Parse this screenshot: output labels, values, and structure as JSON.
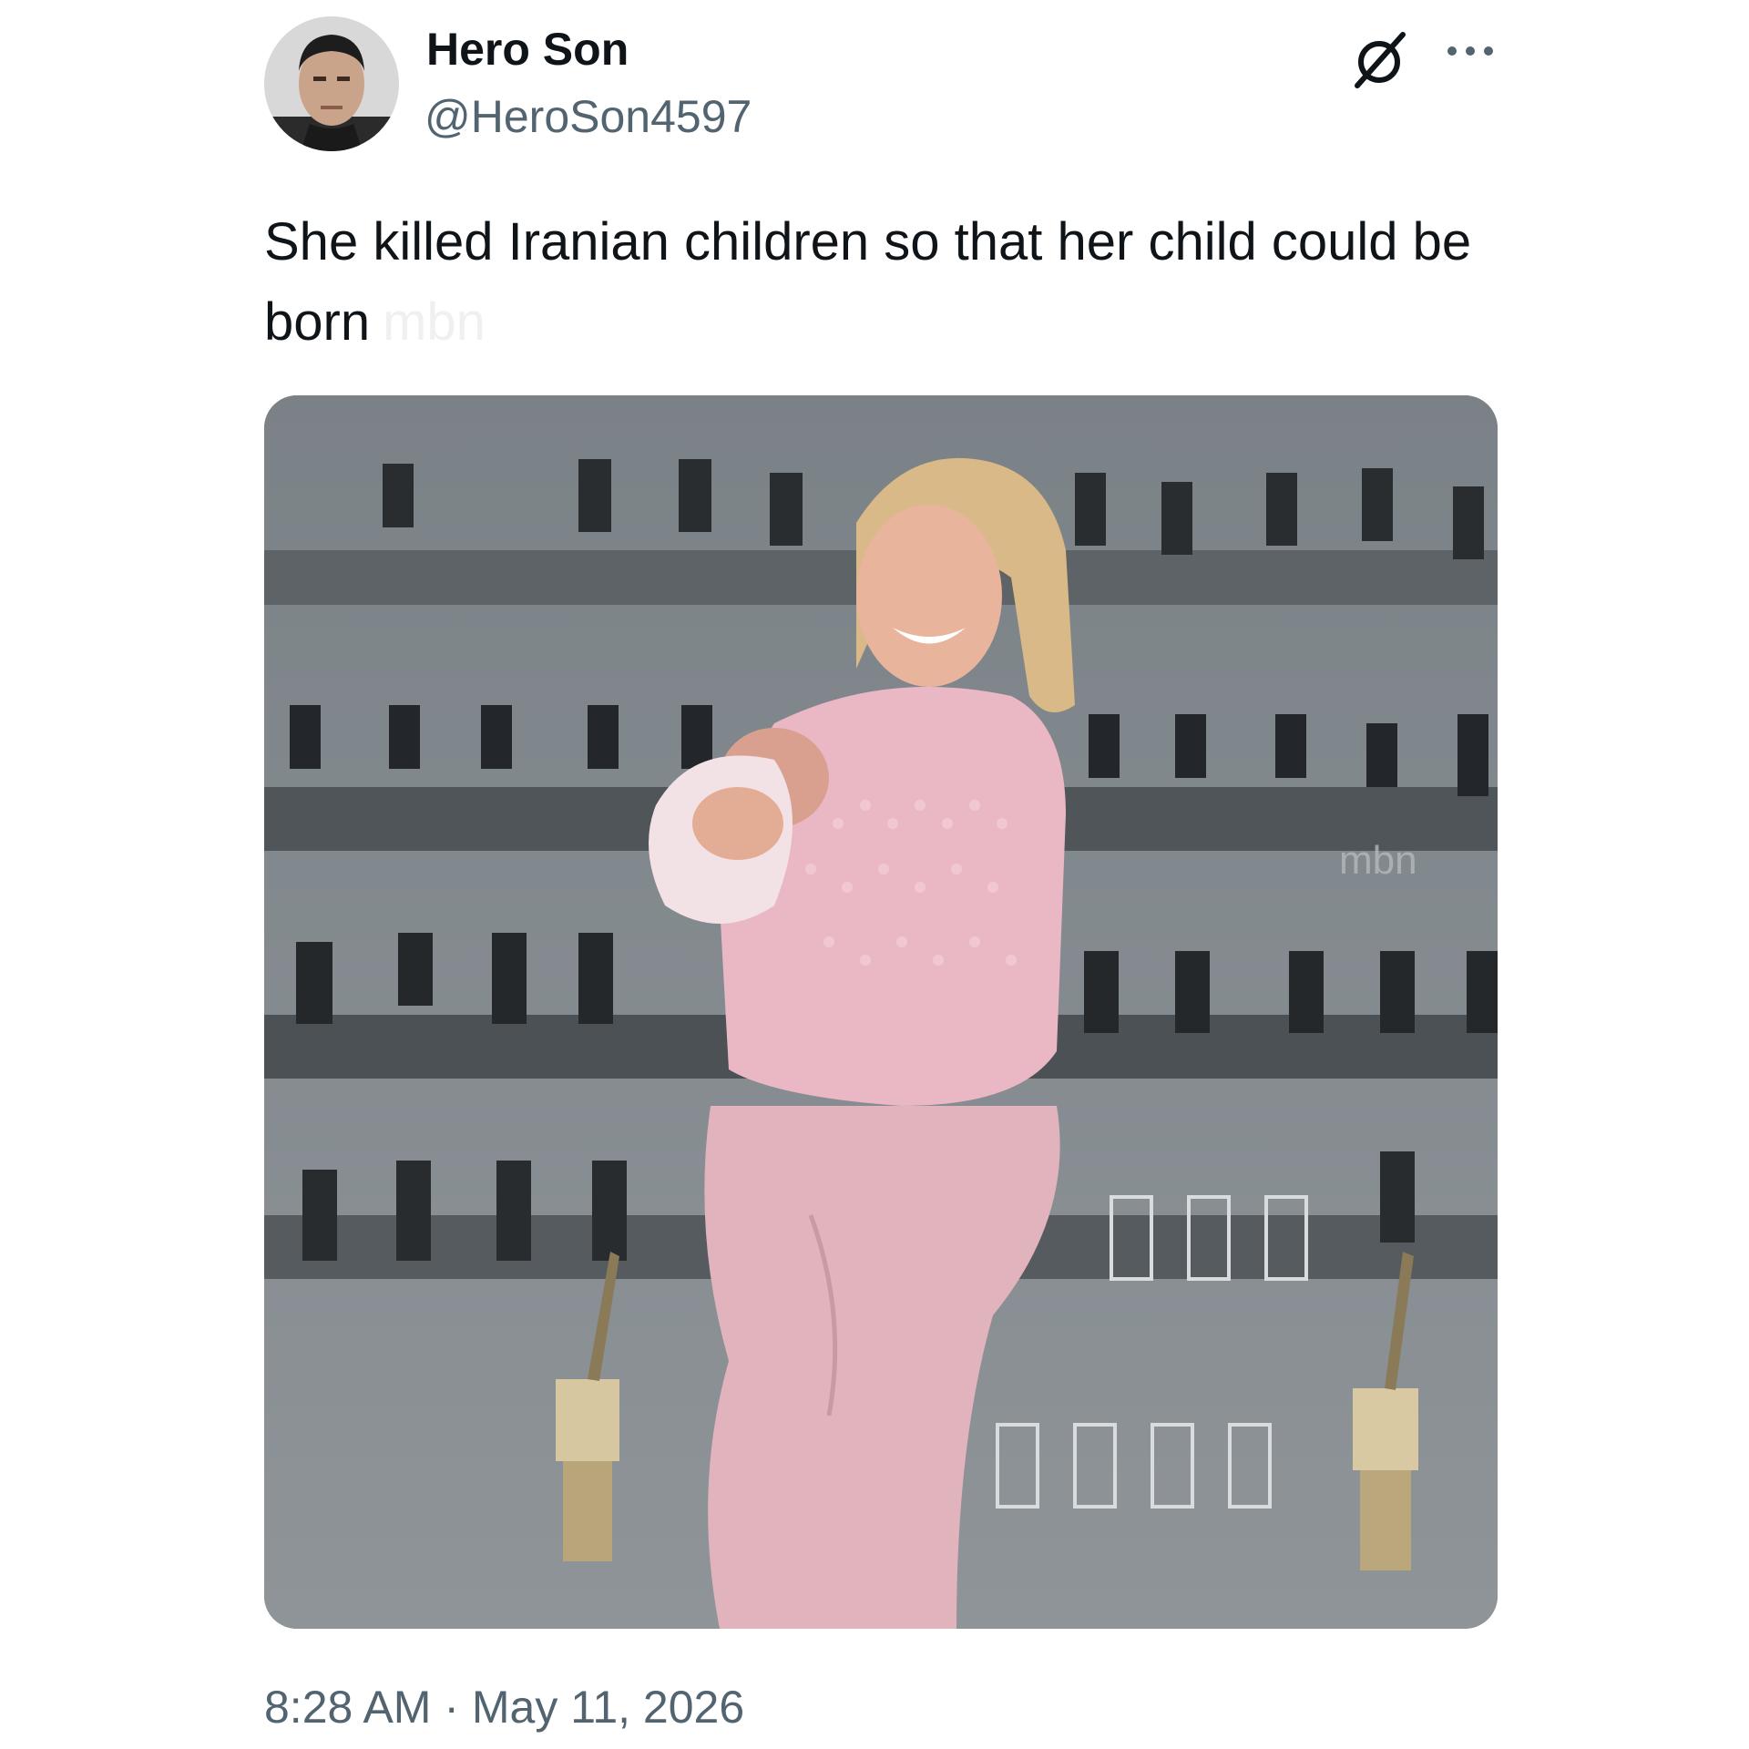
{
  "author": {
    "display_name": "Hero Son",
    "handle": "@HeroSon4597",
    "avatar_icon": "profile-photo"
  },
  "header_actions": {
    "grok_icon": "grok-icon",
    "more_icon": "more-options-icon"
  },
  "tweet": {
    "text": "She killed Iranian children so that her child could be born",
    "inline_watermark": "mbn"
  },
  "media": {
    "watermark": "mbn",
    "description_icon": "attached-photo"
  },
  "meta": {
    "time": "8:28 AM",
    "separator": " · ",
    "date": "May 11, 2026"
  },
  "colors": {
    "text_primary": "#0f1419",
    "text_secondary": "#536471",
    "background": "#ffffff"
  }
}
